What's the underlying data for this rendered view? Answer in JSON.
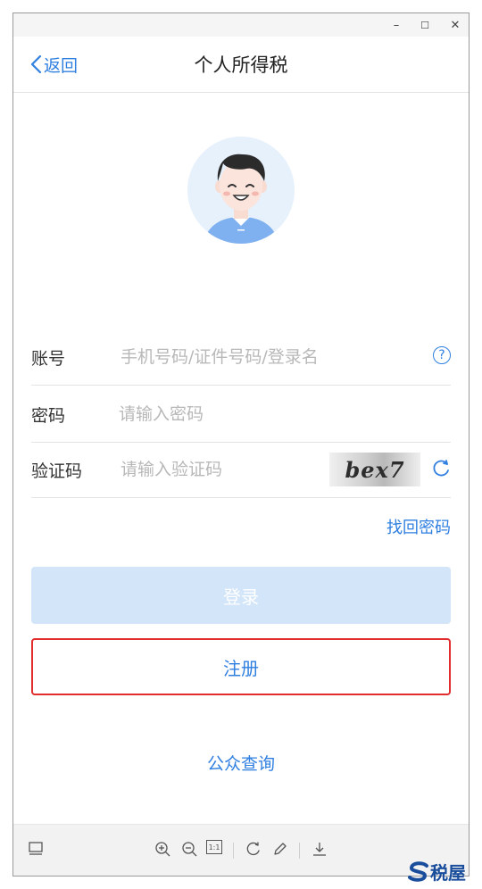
{
  "window": {
    "controls": {
      "minimize": "–",
      "maximize": "☐",
      "close": "✕"
    }
  },
  "appbar": {
    "back_label": "返回",
    "title": "个人所得税"
  },
  "avatar": {
    "icon": "user-avatar"
  },
  "form": {
    "account": {
      "label": "账号",
      "placeholder": "手机号码/证件号码/登录名",
      "help": "?"
    },
    "password": {
      "label": "密码",
      "placeholder": "请输入密码"
    },
    "captcha": {
      "label": "验证码",
      "placeholder": "请输入验证码",
      "image_text": "bex7"
    },
    "forgot_label": "找回密码"
  },
  "buttons": {
    "login_label": "登录",
    "register_label": "注册",
    "public_query_label": "公众查询"
  },
  "toolbar": {
    "icons": [
      "screen-icon",
      "zoom-in-icon",
      "zoom-out-icon",
      "actual-size-icon",
      "rotate-icon",
      "edit-icon",
      "download-icon"
    ],
    "actual_size_label": "1:1"
  },
  "watermark": {
    "text": "税屋"
  },
  "colors": {
    "accent": "#2f7fe0",
    "login_disabled": "#d3e5f9",
    "highlight_border": "#e12d2d"
  }
}
